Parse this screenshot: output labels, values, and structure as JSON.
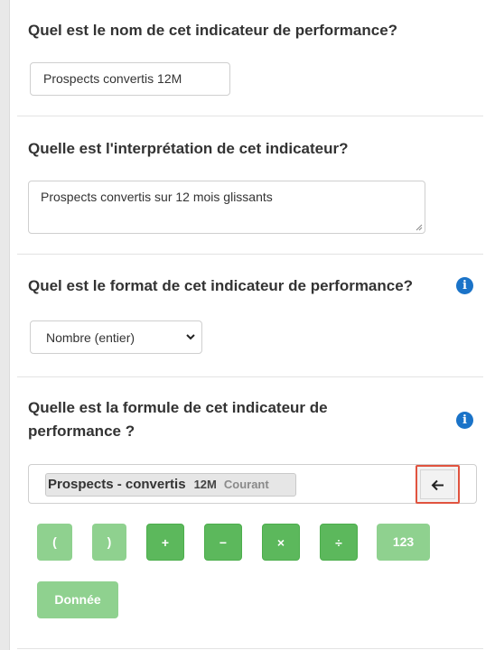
{
  "section_name": {
    "title": "Quel est le nom de cet indicateur de performance?",
    "value": "Prospects convertis 12M"
  },
  "section_interpretation": {
    "title": "Quelle est l'interprétation de cet indicateur?",
    "value": "Prospects convertis sur 12 mois glissants"
  },
  "section_format": {
    "title": "Quel est le format de cet indicateur de performance?",
    "selected": "Nombre (entier)",
    "info_icon": "info-icon"
  },
  "section_formula": {
    "title_line1": "Quelle est la formule de cet indicateur de",
    "title_line2": "performance ?",
    "info_icon": "info-icon",
    "chip": {
      "label": "Prospects - convertis",
      "period": "12M",
      "tag": "Courant"
    },
    "backspace_icon": "arrow-left-icon",
    "operators": [
      "(",
      ")",
      "+",
      "−",
      "×",
      "÷",
      "123"
    ],
    "data_button": "Donnée"
  },
  "colors": {
    "accent_green": "#5cb85c",
    "light_green": "#8fd18f",
    "info_blue": "#1a73c8",
    "highlight_red": "#e0533f"
  }
}
